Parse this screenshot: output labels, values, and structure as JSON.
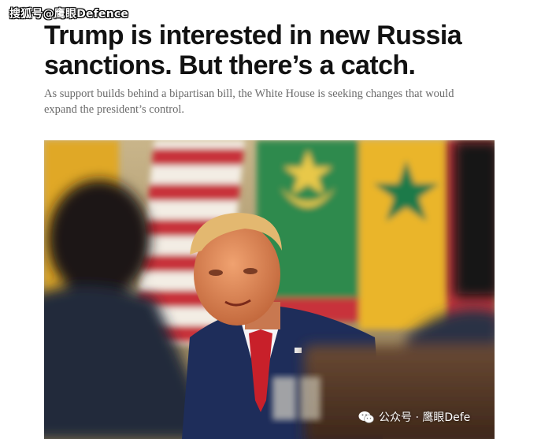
{
  "watermark_top": "搜狐号@鹰眼Defence",
  "headline": "Trump is interested in new Russia sanctions. But there’s a catch.",
  "dek": "As support builds behind a bipartisan bill, the White House is seeking changes that would expand the president’s control.",
  "watermark_bottom": "公众号 · 鹰眼Defe",
  "colors": {
    "headline": "#121212",
    "dek": "#6b6b6b",
    "flag_red": "#c8323a",
    "flag_green": "#2f8a4e",
    "flag_yellow": "#e8b62a",
    "suit": "#1e2d5a",
    "tie": "#c8202a"
  },
  "icons": {
    "wechat": "wechat-icon"
  }
}
